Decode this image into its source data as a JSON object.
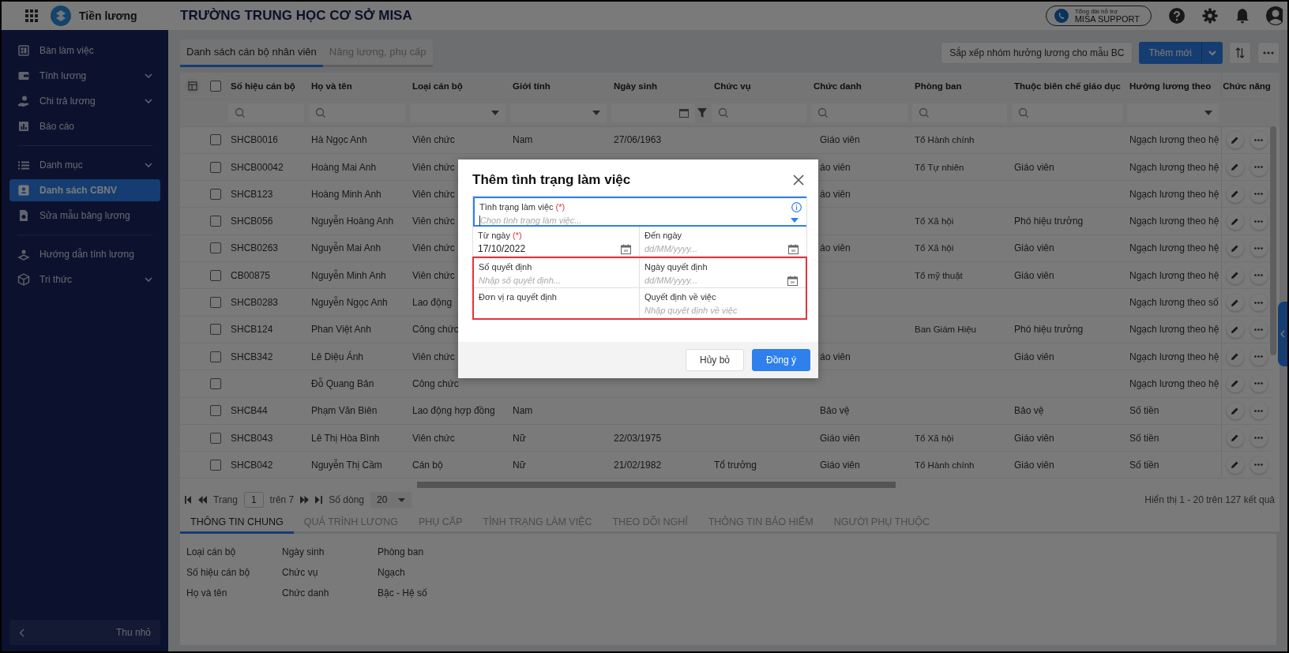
{
  "app": {
    "name": "Tiền lương",
    "school": "TRƯỜNG TRUNG HỌC CƠ SỞ MISA",
    "support": {
      "caption": "Tổng đài hỗ trợ",
      "label": "MISA SUPPORT"
    }
  },
  "sidebar": {
    "items": [
      {
        "label": "Bàn làm việc",
        "expandable": false,
        "selected": false
      },
      {
        "label": "Tính lương",
        "expandable": true,
        "selected": false
      },
      {
        "label": "Chi trả lương",
        "expandable": true,
        "selected": false
      },
      {
        "label": "Báo cáo",
        "expandable": false,
        "selected": false,
        "divider_after": true
      },
      {
        "label": "Danh mục",
        "expandable": true,
        "selected": false
      },
      {
        "label": "Danh sách CBNV",
        "expandable": false,
        "selected": true
      },
      {
        "label": "Sửa mẫu bảng lương",
        "expandable": false,
        "selected": false,
        "divider_after": true
      },
      {
        "label": "Hướng dẫn tính lương",
        "expandable": false,
        "selected": false
      },
      {
        "label": "Tri thức",
        "expandable": true,
        "selected": false
      }
    ],
    "collapse_label": "Thu nhỏ"
  },
  "tabs": [
    {
      "label": "Danh sách cán bộ nhân viên",
      "selected": true
    },
    {
      "label": "Nâng lương, phụ cấp",
      "selected": false
    }
  ],
  "toolbar": {
    "sort_group_button": "Sắp xếp nhóm hưởng lương cho mẫu BC",
    "add_button": "Thêm mới"
  },
  "table": {
    "all_checked": false,
    "columns": [
      {
        "label": "Số hiệu cán bộ",
        "kind": "search"
      },
      {
        "label": "Họ và tên",
        "kind": "search"
      },
      {
        "label": "Loại cán bộ",
        "kind": "select"
      },
      {
        "label": "Giới tính",
        "kind": "select"
      },
      {
        "label": "Ngày sinh",
        "kind": "date"
      },
      {
        "label": "Chức vụ",
        "kind": "search"
      },
      {
        "label": "Chức danh",
        "kind": "search"
      },
      {
        "label": "Phòng ban",
        "kind": "search"
      },
      {
        "label": "Thuộc biên chế giáo dục",
        "kind": "search"
      },
      {
        "label": "Hưởng lương theo",
        "kind": "select"
      },
      {
        "label": "Chức năng",
        "kind": "actions"
      }
    ],
    "rows": [
      {
        "checked": false,
        "cells": [
          "SHCB0016",
          "Hà Ngọc Anh",
          "Viên chức",
          "Nam",
          "27/06/1963",
          null,
          "Giáo viên",
          "Tổ Hành chính",
          null,
          "Ngạch lương theo hệ"
        ]
      },
      {
        "checked": false,
        "cells": [
          "SHCB00042",
          "Hoàng Mai Anh",
          "Viên chức",
          null,
          null,
          null,
          "áo viên",
          "Tổ Tự nhiên",
          "Giáo viên",
          "Ngạch lương theo hệ"
        ]
      },
      {
        "checked": false,
        "cells": [
          "SHCB123",
          "Hoàng Minh Anh",
          "Viên chức",
          null,
          null,
          null,
          "áo viên",
          null,
          null,
          "Ngạch lương theo hệ"
        ]
      },
      {
        "checked": false,
        "cells": [
          "SHCB056",
          "Nguyễn Hoàng Anh",
          "Viên chức",
          null,
          null,
          null,
          null,
          "Tổ Xã hội",
          "Phó hiệu trưởng",
          "Ngạch lương theo hệ"
        ]
      },
      {
        "checked": false,
        "cells": [
          "SHCB0263",
          "Nguyễn Mai Anh",
          "Viên chức",
          null,
          null,
          null,
          "áo viên",
          "Tổ Xã hội",
          "Giáo viên",
          "Ngạch lương theo hệ"
        ]
      },
      {
        "checked": false,
        "cells": [
          "CB00875",
          "Nguyễn Minh Anh",
          "Viên chức",
          null,
          null,
          null,
          null,
          "Tổ mỹ thuật",
          "Giáo viên",
          "Ngạch lương theo hệ"
        ]
      },
      {
        "checked": false,
        "cells": [
          "SHCB0283",
          "Nguyễn Ngọc Anh",
          "Lao động",
          null,
          null,
          null,
          null,
          null,
          null,
          "Ngạch lương theo số"
        ]
      },
      {
        "checked": false,
        "cells": [
          "SHCB124",
          "Phan Việt Anh",
          "Công chức",
          null,
          null,
          null,
          null,
          "Ban Giám Hiệu",
          "Phó hiệu trưởng",
          "Ngạch lương theo hệ"
        ]
      },
      {
        "checked": false,
        "cells": [
          "SHCB342",
          "Lê Diệu Ánh",
          "Viên chức",
          null,
          null,
          null,
          "áo viên",
          null,
          "Giáo viên",
          "Ngạch lương theo hệ"
        ]
      },
      {
        "checked": false,
        "cells": [
          null,
          "Đỗ Quang Bản",
          "Công chức",
          null,
          null,
          null,
          null,
          null,
          null,
          "Ngạch lương theo hệ"
        ]
      },
      {
        "checked": false,
        "cells": [
          "SHCB44",
          "Phạm Văn Biên",
          "Lao động hợp đồng",
          "Nam",
          null,
          null,
          "Bảo vệ",
          null,
          "Bảo vệ",
          "Số tiền"
        ]
      },
      {
        "checked": false,
        "cells": [
          "SHCB043",
          "Lê Thị Hòa Bình",
          "Viên chức",
          "Nữ",
          "22/03/1975",
          null,
          "Giáo viên",
          "Tổ Xã hội",
          "Giáo viên",
          "Số tiền"
        ]
      },
      {
        "checked": false,
        "cells": [
          "SHCB042",
          "Nguyễn Thị Cầm",
          "Cán bộ",
          "Nữ",
          "21/02/1982",
          "Tổ trưởng",
          "Giáo viên",
          "Tổ Hành chính",
          "Giáo viên",
          "Số tiền"
        ]
      }
    ]
  },
  "pagination": {
    "page_label": "Trang",
    "page": "1",
    "of_pages": "trên 7",
    "rows_label": "Số dòng",
    "rows_per_page": "20",
    "summary": "Hiển thị 1 - 20 trên 127 kết quả"
  },
  "detail_tabs": [
    {
      "label": "THÔNG TIN CHUNG",
      "selected": true
    },
    {
      "label": "QUÁ TRÌNH LƯƠNG",
      "selected": false
    },
    {
      "label": "PHỤ CẤP",
      "selected": false
    },
    {
      "label": "TÌNH TRẠNG LÀM VIỆC",
      "selected": false
    },
    {
      "label": "THEO DÕI NGHỈ",
      "selected": false
    },
    {
      "label": "THÔNG TIN BẢO HIỂM",
      "selected": false
    },
    {
      "label": "NGƯỜI PHỤ THUỘC",
      "selected": false
    }
  ],
  "detail_fields": [
    "Loại cán bộ",
    "Ngày sinh",
    "Phòng ban",
    "Số hiệu cán bộ",
    "Chức vụ",
    "Ngạch",
    "Họ và tên",
    "Chức danh",
    "Bậc - Hệ số"
  ],
  "dialog": {
    "title": "Thêm tình trạng làm việc",
    "fields": [
      {
        "kind": "select",
        "label": "Tình trạng làm việc",
        "required_mark": "(*)",
        "placeholder": "Chọn tình trạng làm việc...",
        "focused": true
      },
      {
        "kind": "date",
        "label": "Từ ngày",
        "required_mark": "(*)",
        "value": "17/10/2022"
      },
      {
        "kind": "date",
        "label": "Đến ngày",
        "placeholder": "dd/MM/yyyy..."
      }
    ],
    "highlighted_fields": [
      {
        "kind": "text",
        "label": "Số quyết định",
        "placeholder": "Nhập số quyết định..."
      },
      {
        "kind": "date",
        "label": "Ngày quyết định",
        "placeholder": "dd/MM/yyyy..."
      },
      {
        "kind": "text",
        "label": "Đơn vị ra quyết định"
      },
      {
        "kind": "text",
        "label": "Quyết định về việc",
        "placeholder": "Nhập quyết định về việc"
      }
    ],
    "buttons": [
      {
        "label": "Hủy bỏ",
        "kind": "secondary"
      },
      {
        "label": "Đồng ý",
        "kind": "primary"
      }
    ]
  }
}
